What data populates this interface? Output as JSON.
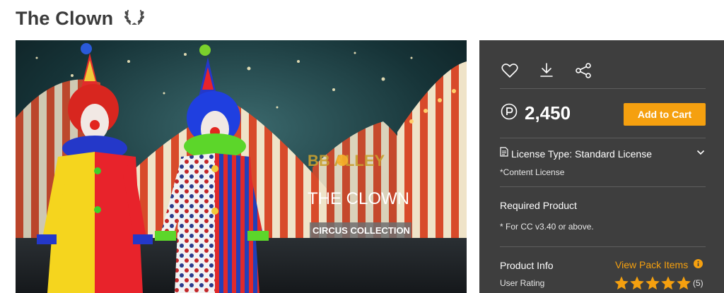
{
  "product": {
    "title": "The Clown",
    "badge_icon": "laurel-wreath-icon"
  },
  "hero": {
    "brand": "BB ALLEY",
    "name": "THE CLOWN",
    "collection": "CIRCUS COLLECTION"
  },
  "panel": {
    "icons": [
      "heart-icon",
      "download-icon",
      "share-icon"
    ],
    "price": "2,450",
    "currency_icon": "points-icon",
    "add_to_cart": "Add to Cart",
    "license_type": "License Type: Standard License",
    "content_license": "*Content License",
    "required_product_heading": "Required Product",
    "required_product_note": "* For CC v3.40 or above.",
    "product_info_heading": "Product Info",
    "view_pack_items": "View Pack Items",
    "user_rating_label": "User Rating",
    "rating": 5,
    "rating_count": "(5)"
  },
  "colors": {
    "accent": "#f5a00f",
    "panel_bg": "#3e3e3e",
    "title": "#3b3b3b"
  }
}
